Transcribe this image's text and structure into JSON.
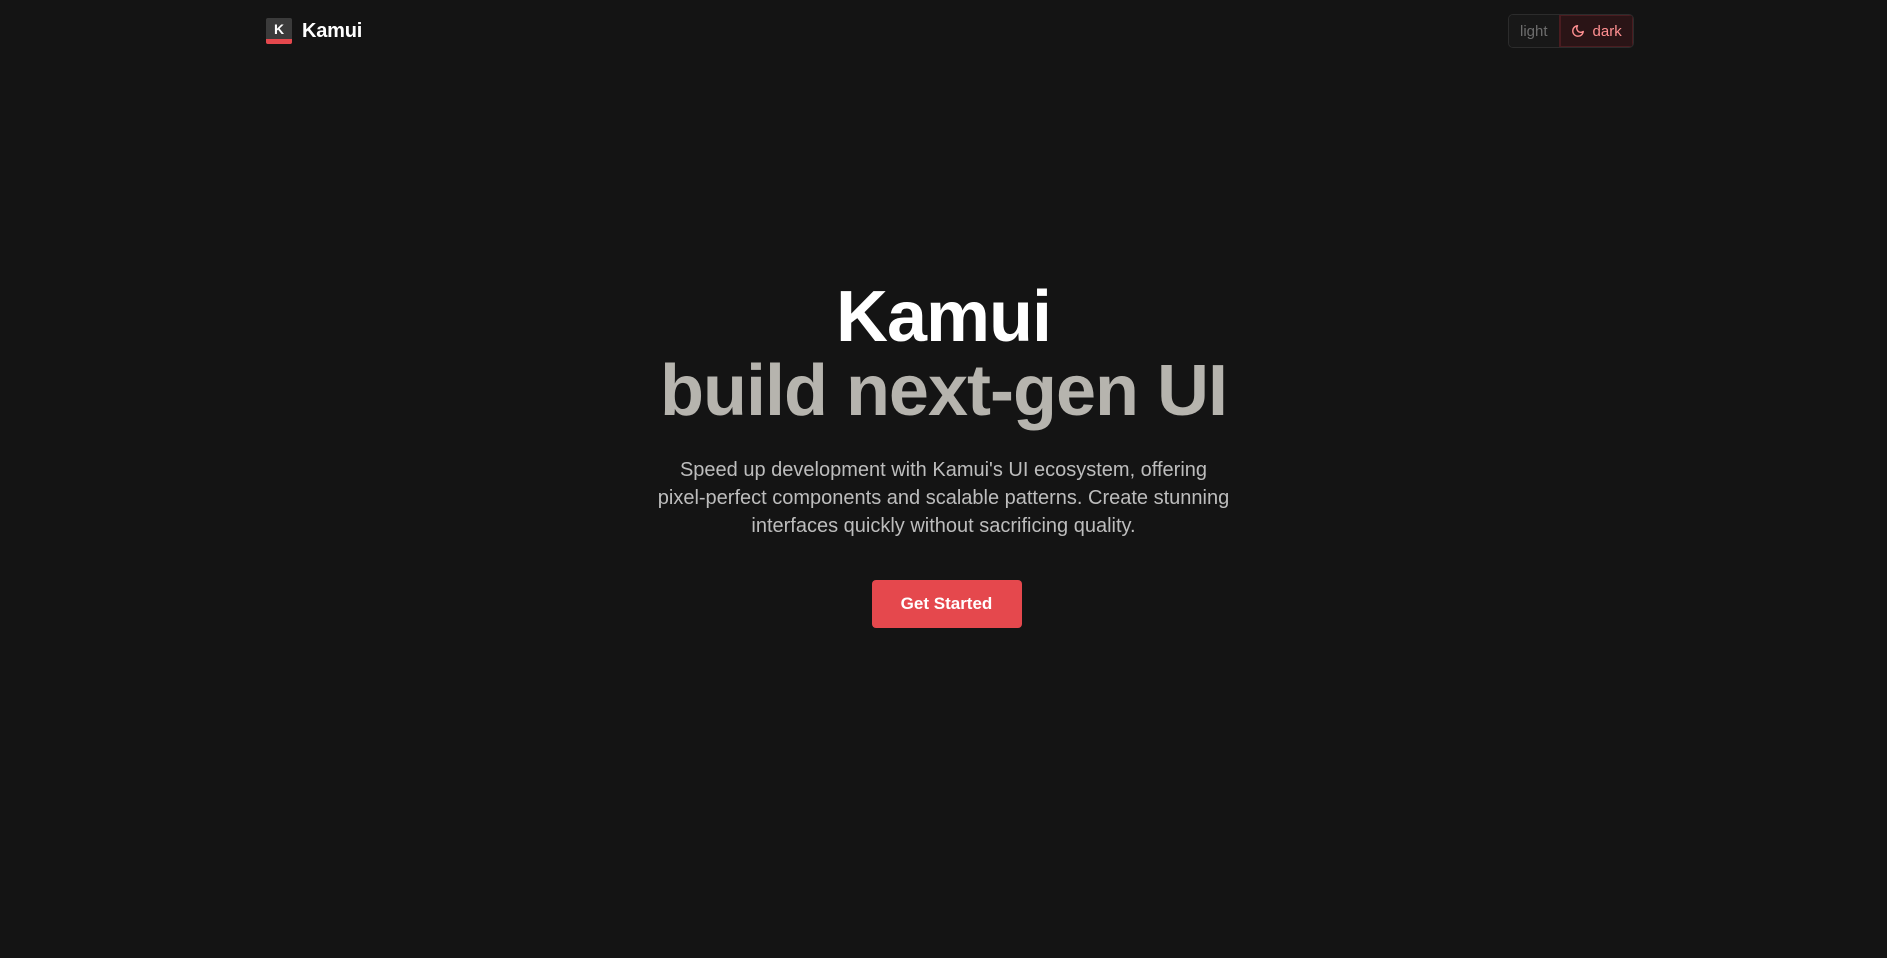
{
  "header": {
    "logo_letter": "K",
    "brand_name": "Kamui",
    "theme_switch": {
      "light_label": "light",
      "dark_label": "dark",
      "selected": "dark",
      "dark_icon": "moon-icon"
    }
  },
  "hero": {
    "title": "Kamui",
    "subtitle": "build next-gen UI",
    "description": "Speed up development with Kamui's UI ecosystem, offering pixel-perfect components and scalable patterns. Create stunning interfaces quickly without sacrificing quality.",
    "cta_label": "Get Started"
  },
  "colors": {
    "background": "#141414",
    "accent": "#e5484d",
    "subtitle": "#b6b4ae"
  }
}
